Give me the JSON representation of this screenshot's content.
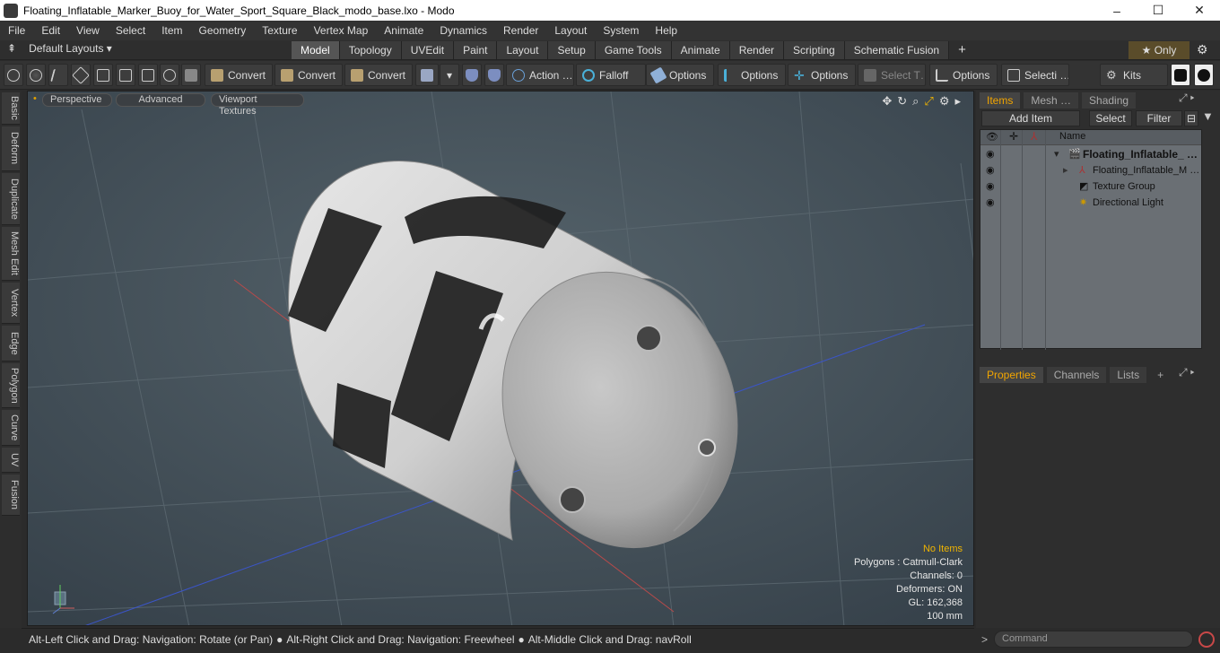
{
  "window": {
    "title": "Floating_Inflatable_Marker_Buoy_for_Water_Sport_Square_Black_modo_base.lxo - Modo",
    "controls": [
      "–",
      "☐",
      "✕"
    ]
  },
  "menu": [
    "File",
    "Edit",
    "View",
    "Select",
    "Item",
    "Geometry",
    "Texture",
    "Vertex Map",
    "Animate",
    "Dynamics",
    "Render",
    "Layout",
    "System",
    "Help"
  ],
  "layoutbar": {
    "layouts_label": "Default Layouts ▾",
    "tabs": [
      "Model",
      "Topology",
      "UVEdit",
      "Paint",
      "Layout",
      "Setup",
      "Game Tools",
      "Animate",
      "Render",
      "Scripting",
      "Schematic Fusion"
    ],
    "active_tab": "Model",
    "add_label": "+",
    "only_label": "★  Only",
    "gear": "⚙"
  },
  "toolbar": {
    "convert1": "Convert",
    "convert2": "Convert",
    "convert3": "Convert",
    "action": "Action …",
    "falloff": "Falloff",
    "options1": "Options",
    "options2": "Options",
    "options3": "Options",
    "select_t": "Select T…",
    "options4": "Options",
    "selecti": "Selecti …",
    "kits": "Kits"
  },
  "lefttabs": [
    "Basic",
    "Deform",
    "Duplicate",
    "Mesh Edit",
    "Vertex",
    "Edge",
    "Polygon",
    "Curve",
    "UV",
    "Fusion"
  ],
  "viewport": {
    "perspective": "Perspective",
    "advanced": "Advanced",
    "textures": "Viewport Textures",
    "info": {
      "no_items": "No Items",
      "polygons": "Polygons : Catmull-Clark",
      "channels": "Channels: 0",
      "deformers": "Deformers: ON",
      "gl": "GL: 162,368",
      "scale": "100 mm"
    }
  },
  "status": {
    "hint1": "Alt-Left Click and Drag: Navigation: Rotate (or Pan)",
    "hint2": "Alt-Right Click and Drag: Navigation: Freewheel",
    "hint3": "Alt-Middle Click and Drag: navRoll"
  },
  "rightpanel": {
    "tabs": [
      "Items",
      "Mesh …",
      "Shading"
    ],
    "add_item": "Add Item",
    "select": "Select",
    "filter": "Filter",
    "name_col": "Name",
    "items": [
      {
        "label": "Floating_Inflatable_ …",
        "bold": true
      },
      {
        "label": "Floating_Inflatable_M …",
        "bold": false
      },
      {
        "label": "Texture Group",
        "bold": false
      },
      {
        "label": "Directional Light",
        "bold": false
      }
    ],
    "bottom_tabs": [
      "Properties",
      "Channels",
      "Lists"
    ],
    "command_placeholder": "Command"
  },
  "colors": {
    "accent": "#f2a500",
    "viewport_bg": "#48545c",
    "buoy_white": "#d9d9d9",
    "buoy_black": "#1e1e1e"
  }
}
